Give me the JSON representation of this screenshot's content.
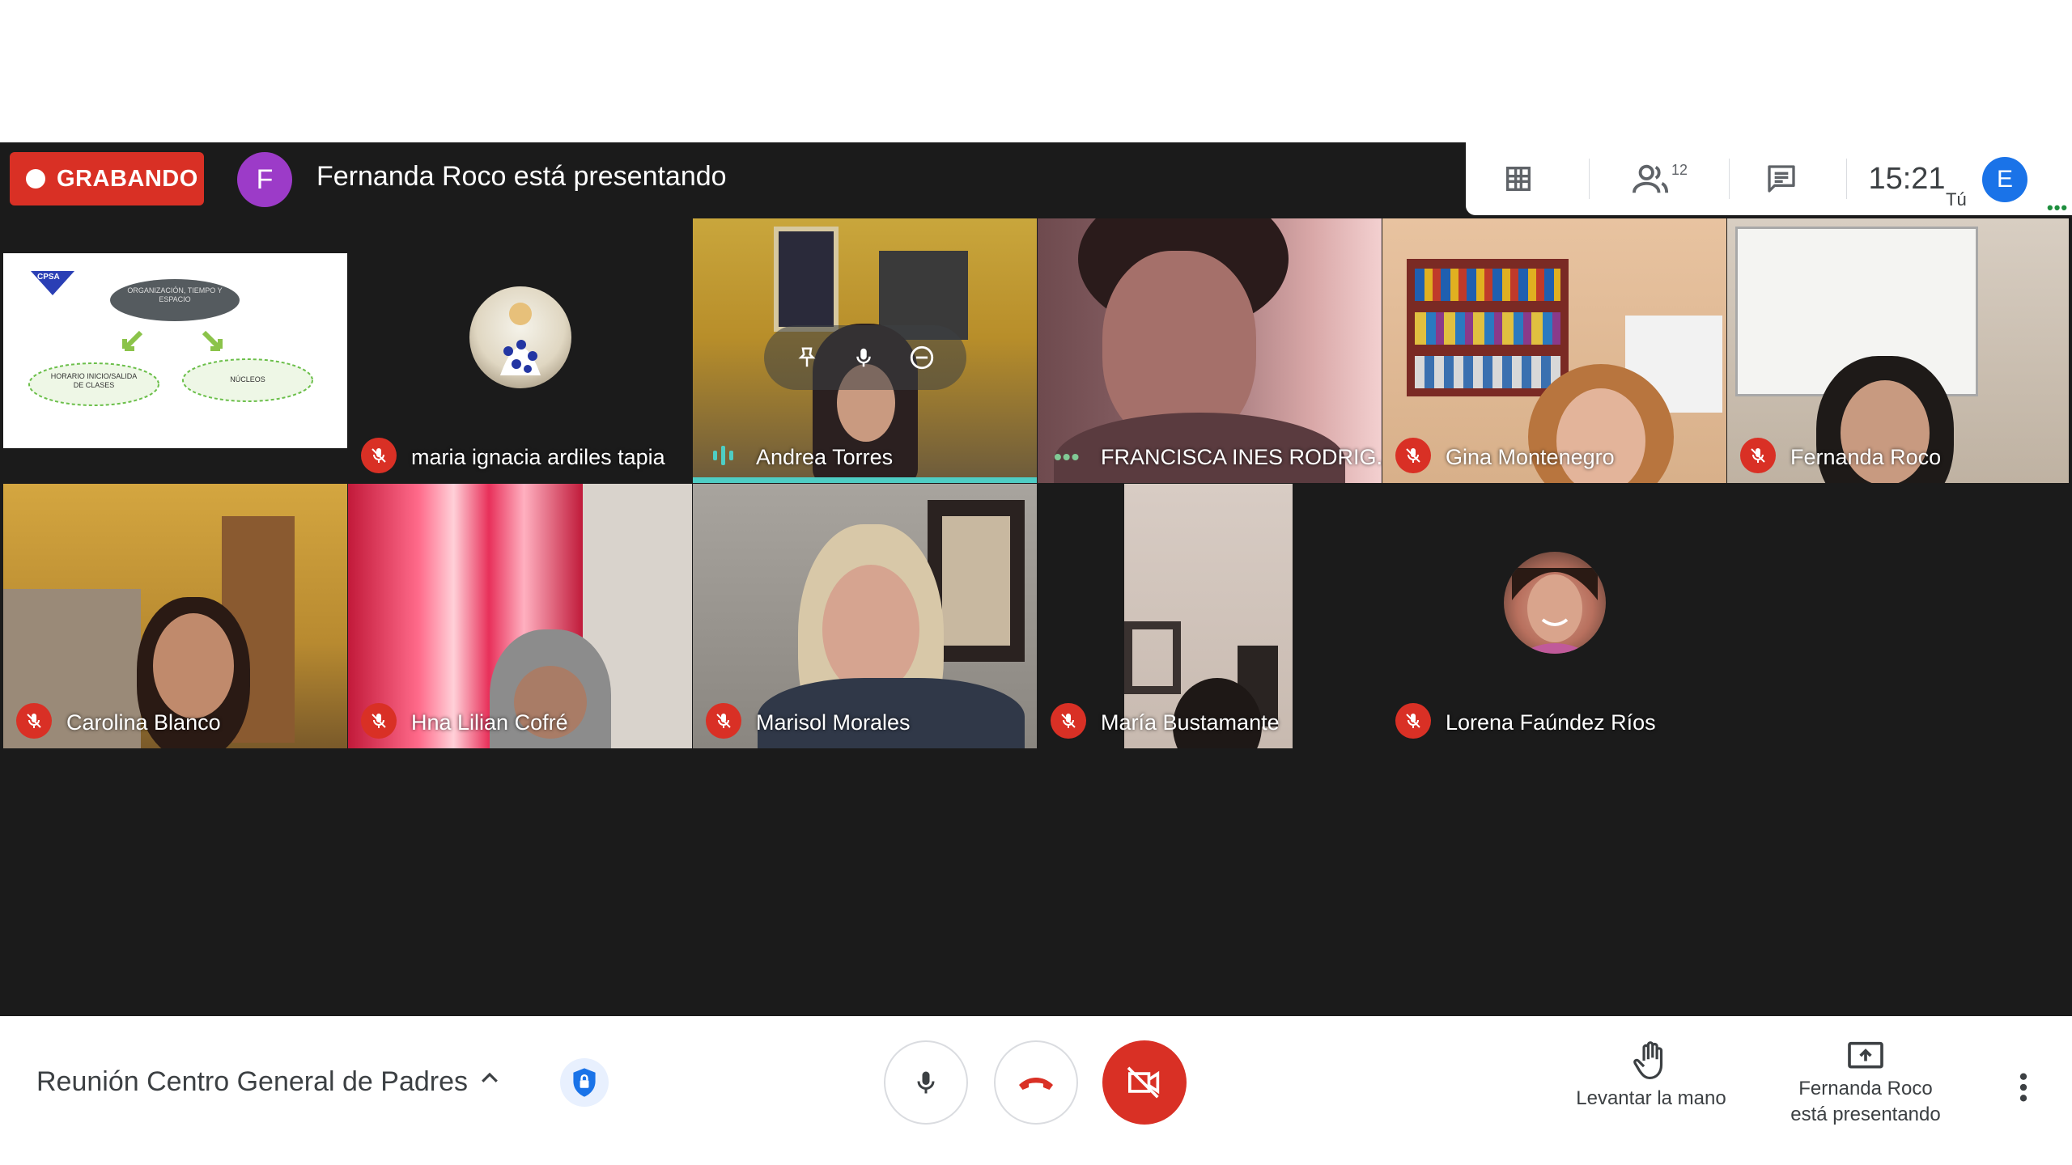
{
  "recording": {
    "label": "GRABANDO"
  },
  "presenter": {
    "initial": "F",
    "text": "Fernanda Roco está presentando"
  },
  "top_tools": {
    "grid_icon": "grid-icon",
    "people_count": "12",
    "chat_icon": "chat-icon",
    "time": "15:21",
    "you_label": "Tú",
    "self_initial": "E"
  },
  "presentation_slide": {
    "logo": "CPSA",
    "center_node": "ORGANIZACIÓN, TIEMPO Y ESPACIO",
    "left_node": "HORARIO INICIO/SALIDA DE CLASES",
    "right_node": "NÚCLEOS"
  },
  "participants": [
    {
      "name": "maria ignacia ardiles tapia",
      "status": "muted"
    },
    {
      "name": "Andrea Torres",
      "status": "speaking"
    },
    {
      "name": "FRANCISCA INES RODRIG...",
      "status": "dots"
    },
    {
      "name": "Gina Montenegro",
      "status": "muted"
    },
    {
      "name": "Fernanda Roco",
      "status": "muted"
    },
    {
      "name": "Carolina Blanco",
      "status": "muted"
    },
    {
      "name": "Hna Lilian Cofré",
      "status": "muted"
    },
    {
      "name": "Marisol Morales",
      "status": "muted"
    },
    {
      "name": "María Bustamante",
      "status": "muted"
    },
    {
      "name": "Lorena Faúndez Ríos",
      "status": "muted"
    }
  ],
  "bottom_bar": {
    "meeting_title": "Reunión Centro General de Padres",
    "raise_hand_label": "Levantar la mano",
    "presenting_label": "Fernanda Roco\nestá presentando"
  },
  "colors": {
    "record_red": "#d93025",
    "presenter_purple": "#9c3bc8",
    "self_blue": "#1a73e8",
    "speaker_teal": "#4ecdc4"
  }
}
